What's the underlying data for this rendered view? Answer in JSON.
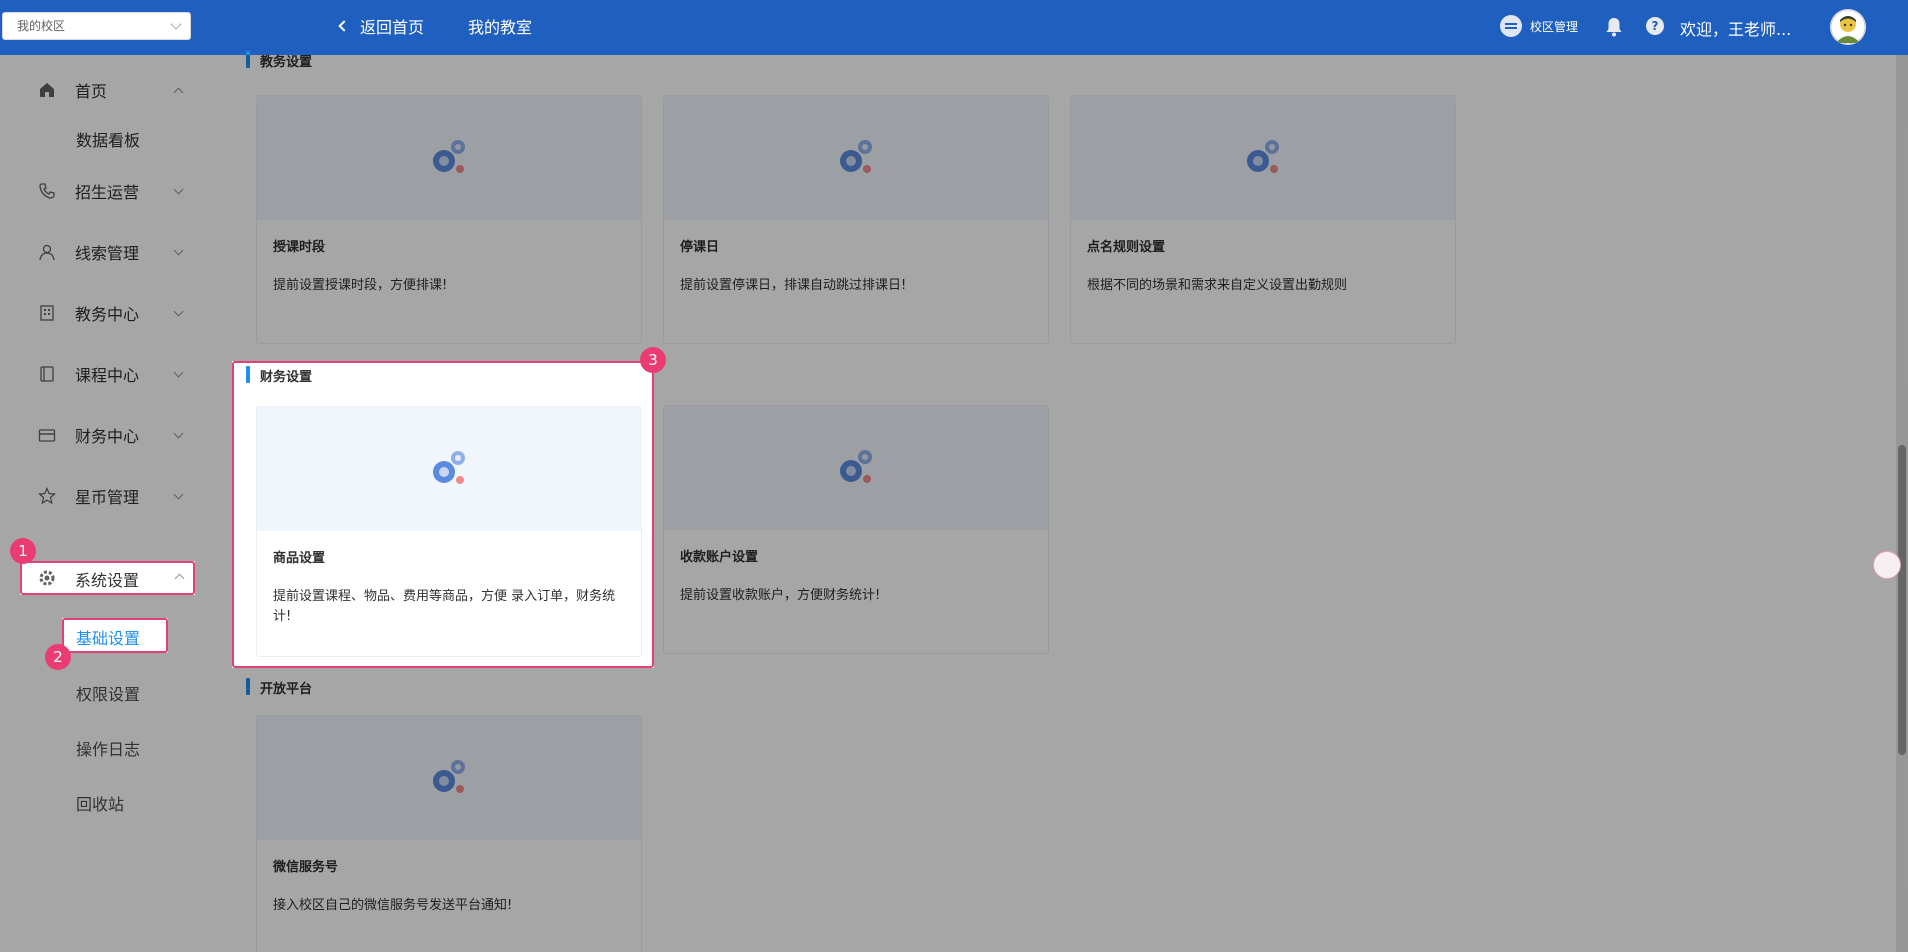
{
  "topbar": {
    "campus_select": "我的校区",
    "back_home": "返回首页",
    "my_classroom": "我的教室",
    "campus_management": "校区管理",
    "welcome": "欢迎，王老师..."
  },
  "sidebar": {
    "home": "首页",
    "dashboard": "数据看板",
    "enrollment": "招生运营",
    "leads": "线索管理",
    "academic": "教务中心",
    "courses": "课程中心",
    "finance": "财务中心",
    "stars": "星币管理",
    "system": "系统设置",
    "basic_settings": "基础设置",
    "permissions": "权限设置",
    "operation_log": "操作日志",
    "recycle_bin": "回收站"
  },
  "sections": {
    "academic_settings": "教务设置",
    "finance_settings": "财务设置",
    "open_platform": "开放平台"
  },
  "cards": {
    "class_periods": {
      "title": "授课时段",
      "desc": "提前设置授课时段，方便排课!"
    },
    "suspension_days": {
      "title": "停课日",
      "desc": "提前设置停课日，排课自动跳过排课日!"
    },
    "rollcall_rules": {
      "title": "点名规则设置",
      "desc": "根据不同的场景和需求来自定义设置出勤规则"
    },
    "product_settings": {
      "title": "商品设置",
      "desc": "提前设置课程、物品、费用等商品，方便 录入订单，财务统计!"
    },
    "payment_accounts": {
      "title": "收款账户设置",
      "desc": "提前设置收款账户，方便财务统计!"
    },
    "wechat_service": {
      "title": "微信服务号",
      "desc": "接入校区自己的微信服务号发送平台通知!"
    }
  },
  "badges": {
    "b1": "1",
    "b2": "2",
    "b3": "3"
  },
  "colors": {
    "topbar": "#1f5fbf",
    "accent": "#1f8ff0",
    "highlight": "#e0417a"
  }
}
